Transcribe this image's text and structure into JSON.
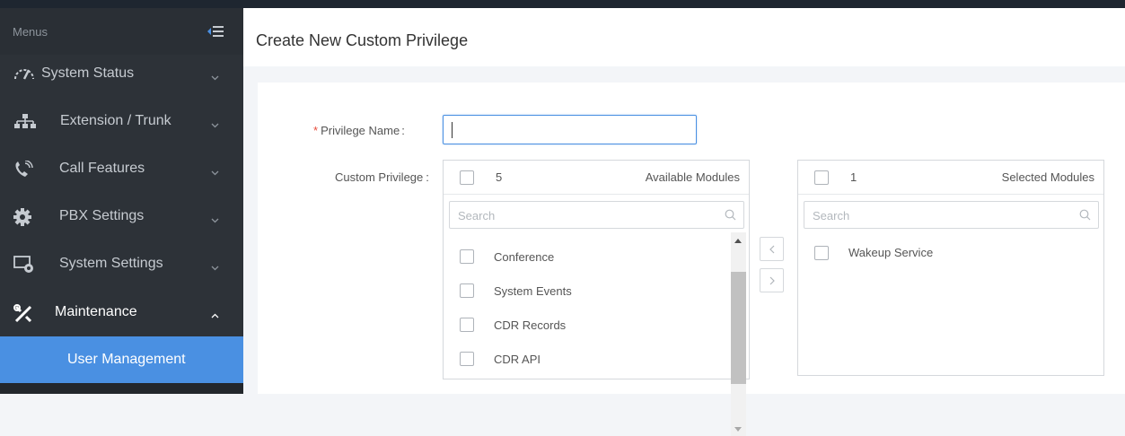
{
  "sidebar": {
    "header": "Menus",
    "items": [
      {
        "label": "System Status",
        "icon": "gauge-icon",
        "expanded": false
      },
      {
        "label": "Extension / Trunk",
        "icon": "network-icon",
        "expanded": false
      },
      {
        "label": "Call Features",
        "icon": "phone-icon",
        "expanded": false
      },
      {
        "label": "PBX Settings",
        "icon": "gear-icon",
        "expanded": false
      },
      {
        "label": "System Settings",
        "icon": "monitor-settings-icon",
        "expanded": false
      },
      {
        "label": "Maintenance",
        "icon": "tools-icon",
        "expanded": true
      }
    ],
    "active_subitem": "User Management"
  },
  "page": {
    "title": "Create New Custom Privilege"
  },
  "form": {
    "privilege_name_label": "Privilege Name",
    "privilege_name_value": "",
    "custom_privilege_label": "Custom Privilege",
    "label_colon": ":"
  },
  "available": {
    "count": "5",
    "title": "Available Modules",
    "search_placeholder": "Search",
    "items": [
      "Conference",
      "System Events",
      "CDR Records",
      "CDR API"
    ]
  },
  "selected": {
    "count": "1",
    "title": "Selected Modules",
    "search_placeholder": "Search",
    "items": [
      "Wakeup Service"
    ]
  },
  "colors": {
    "accent": "#4a90e2",
    "sidebar_bg": "#2d3238",
    "required": "#e74c3c"
  }
}
